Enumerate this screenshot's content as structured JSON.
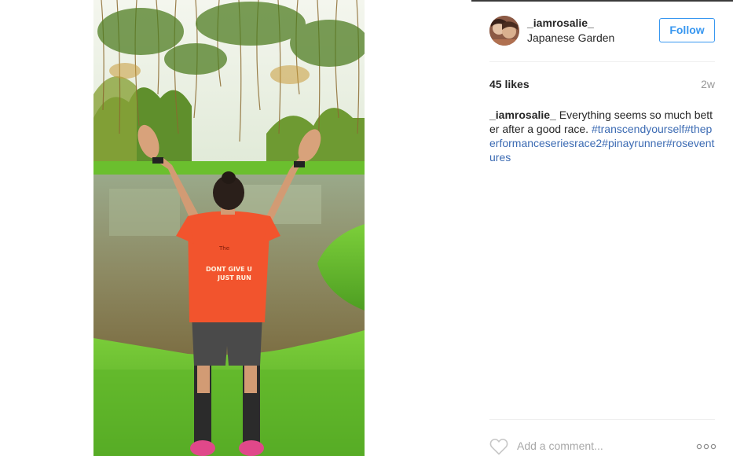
{
  "post": {
    "username": "_iamrosalie_",
    "location": "Japanese Garden",
    "follow_label": "Follow",
    "likes": "45 likes",
    "time_ago": "2w",
    "caption_user": "_iamrosalie_",
    "caption_text": " Everything seems so much better after a good race. ",
    "hashtags": [
      "#transcendyourself",
      "#theperformanceseriesrace2",
      "#pinayrunner",
      "#roseventures"
    ],
    "comment_placeholder": "Add a comment..."
  },
  "photo": {
    "shirt_text_1": "The",
    "shirt_text_2": "DONT GIVE U",
    "shirt_text_3": "JUST RUN"
  },
  "icons": {
    "heart": "heart-icon",
    "more": "more-options-icon"
  },
  "colors": {
    "accent": "#3897f0",
    "hashtag": "#3c6bb3",
    "muted": "#999999"
  }
}
